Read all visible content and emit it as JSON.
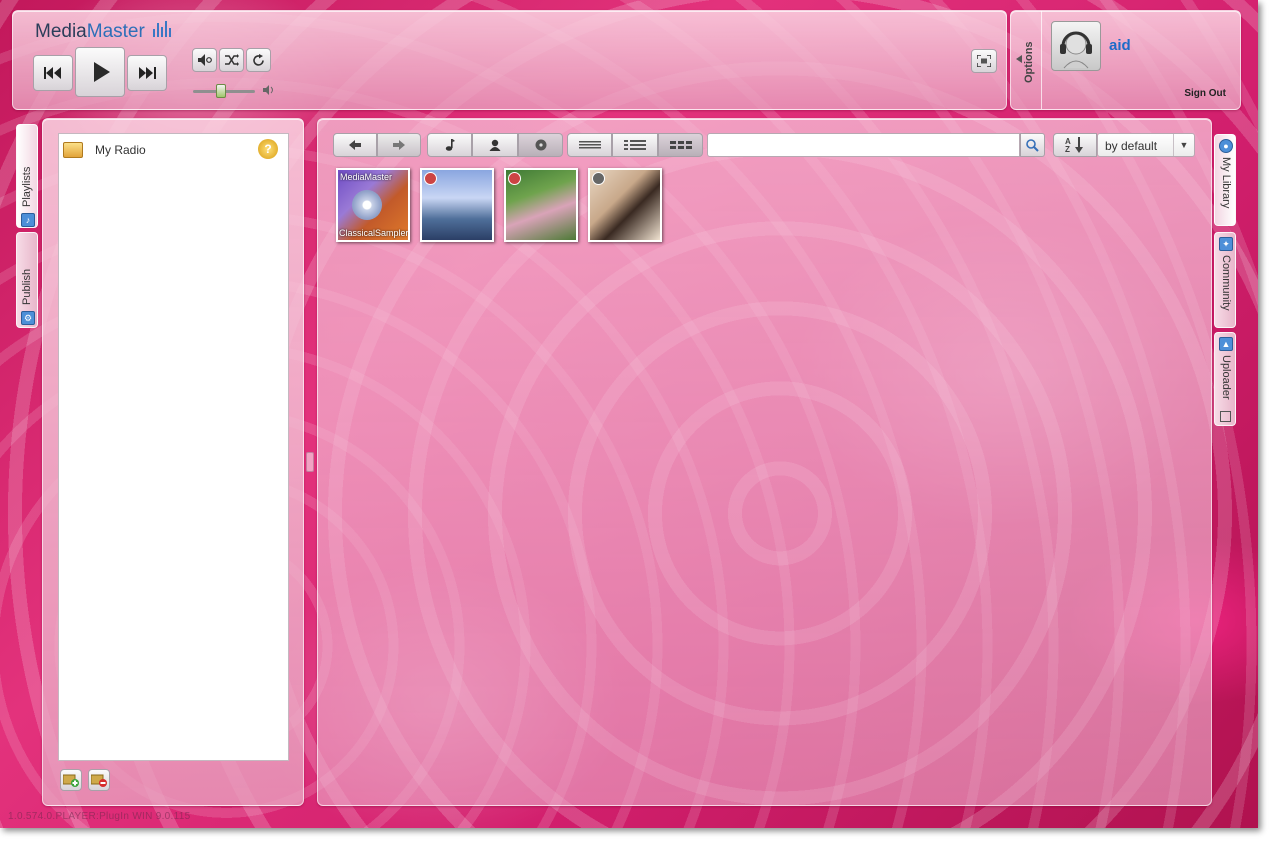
{
  "app": {
    "logo_part1": "Media",
    "logo_part2": "Master"
  },
  "player": {
    "prev_icon": "skip-back-icon",
    "play_icon": "play-icon",
    "next_icon": "skip-forward-icon",
    "mute_icon": "mute-icon",
    "shuffle_icon": "shuffle-icon",
    "repeat_icon": "repeat-icon",
    "volume_level": 0.45,
    "fullscreen_icon": "fullscreen-icon"
  },
  "user": {
    "options_label": "Options",
    "name": "aid",
    "sign_out_label": "Sign Out"
  },
  "left_tabs": {
    "playlists": "Playlists",
    "publish": "Publish"
  },
  "playlists": {
    "items": [
      {
        "label": "My Radio"
      }
    ]
  },
  "toolbar": {
    "search_placeholder": "",
    "sort_value": "by default"
  },
  "right_tabs": {
    "library": "My Library",
    "community": "Community",
    "uploader": "Uploader"
  },
  "albums": [
    {
      "top_text": "MediaMaster",
      "bottom_text": "ClassicalSampler"
    },
    {
      "top_text": "",
      "bottom_text": ""
    },
    {
      "top_text": "",
      "bottom_text": ""
    },
    {
      "top_text": "",
      "bottom_text": ""
    }
  ],
  "status": {
    "text": "1.0.574.0.PLAYER:PlugIn WIN 9.0.115"
  },
  "colors": {
    "accent": "#2c6fb8",
    "username": "#1d6bc8",
    "background": "#d21f6d"
  }
}
